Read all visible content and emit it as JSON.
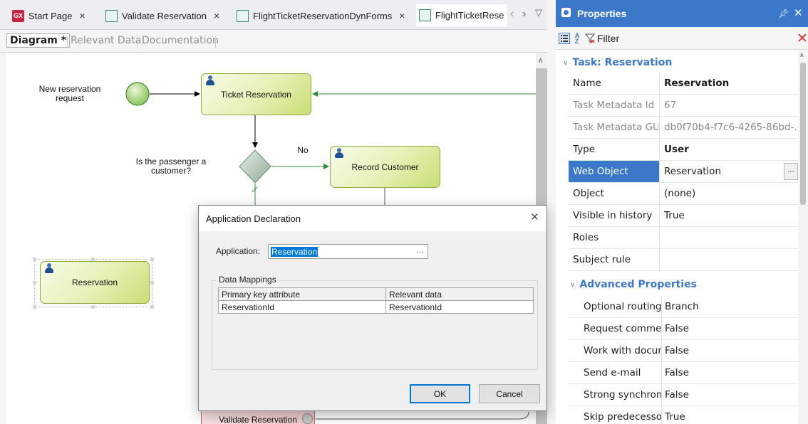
{
  "tabs": [
    {
      "label": "Start Page",
      "icon": "genexus-logo-icon",
      "close": "×"
    },
    {
      "label": "Validate Reservation",
      "icon": "workflow-diagram-icon",
      "close": "×"
    },
    {
      "label": "FlightTicketReservationDynForms",
      "icon": "workflow-diagram-icon",
      "close": "×"
    },
    {
      "label": "FlightTicketRese",
      "icon": "workflow-diagram-icon",
      "active": true
    }
  ],
  "subtabs": [
    "Diagram *",
    "Relevant Data",
    "Documentation"
  ],
  "diagram": {
    "start_label": "New reservation request",
    "decision_label": "Is the passenger a customer?",
    "edge_no": "No",
    "tasks": {
      "ticket": "Ticket Reservation",
      "record": "Record Customer",
      "reservation": "Reservation",
      "validate": "Validate Reservation"
    }
  },
  "dialog": {
    "title": "Application Declaration",
    "app_label": "Application:",
    "app_value": "Reservation",
    "app_button": "...",
    "group_label": "Data Mappings",
    "columns": [
      "Primary key attribute",
      "Relevant data"
    ],
    "rows": [
      [
        "ReservationId",
        "ReservationId"
      ]
    ],
    "ok": "OK",
    "cancel": "Cancel",
    "close": "×"
  },
  "properties": {
    "title": "Properties",
    "filter": "Filter",
    "category_task": "Task: Reservation",
    "category_advanced": "Advanced Properties",
    "rows": [
      {
        "name": "Name",
        "value": "Reservation",
        "style": "bold"
      },
      {
        "name": "Task Metadata Id",
        "value": "67",
        "style": "dim"
      },
      {
        "name": "Task Metadata GUID",
        "value": "db0f70b4-f7c6-4265-86bd-...",
        "style": "dim"
      },
      {
        "name": "Type",
        "value": "User",
        "style": "bold"
      },
      {
        "name": "Web Object",
        "value": "Reservation",
        "style": "selected",
        "button": "..."
      },
      {
        "name": "Object",
        "value": "(none)"
      },
      {
        "name": "Visible in history",
        "value": "True"
      },
      {
        "name": "Roles",
        "value": ""
      },
      {
        "name": "Subject rule",
        "value": ""
      }
    ],
    "advanced_rows": [
      {
        "name": "Optional routing",
        "value": "Branch"
      },
      {
        "name": "Request comments",
        "value": "False"
      },
      {
        "name": "Work with documents",
        "value": "False"
      },
      {
        "name": "Send e-mail",
        "value": "False"
      },
      {
        "name": "Strong synchronization",
        "value": "False"
      },
      {
        "name": "Skip predecessor",
        "value": "True"
      }
    ]
  },
  "colors": {
    "accent": "#3b78c9",
    "task_fill": "#e5f0b4",
    "task_border": "#8ea843",
    "edge_green": "#2e8b3d",
    "selection": "#0078d7"
  }
}
